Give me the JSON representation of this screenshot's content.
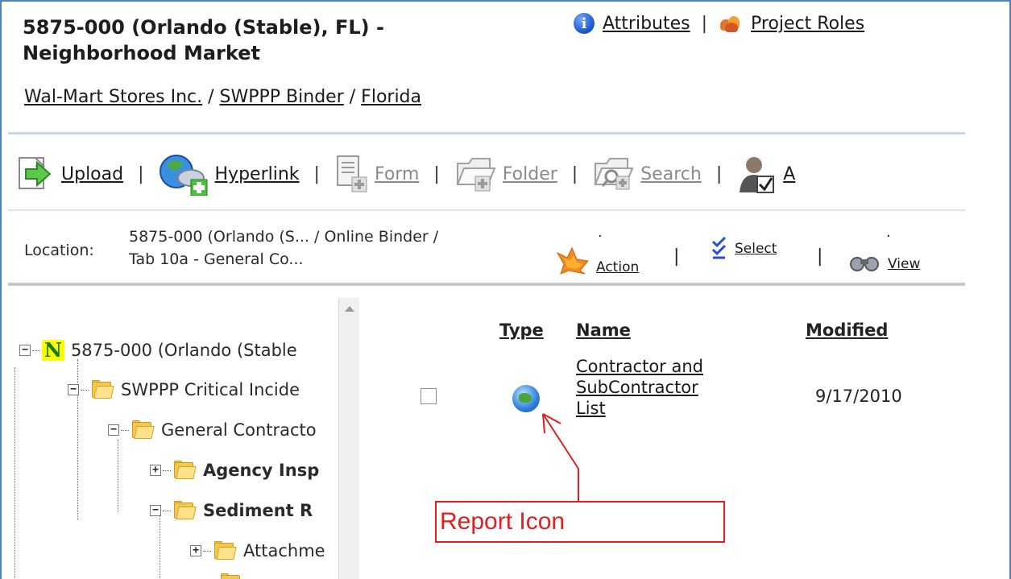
{
  "header": {
    "title": "5875-000 (Orlando (Stable), FL) - Neighborhood Market",
    "attributes_label": "Attributes",
    "separator": "|",
    "project_roles_label": "Project Roles"
  },
  "breadcrumb": {
    "items": [
      "Wal-Mart Stores Inc.",
      "SWPPP Binder",
      "Florida"
    ],
    "separator": " / "
  },
  "toolbar": {
    "items": [
      {
        "label": "Upload",
        "icon": "upload-icon",
        "enabled": true
      },
      {
        "label": "Hyperlink",
        "icon": "hyperlink-globe-icon",
        "enabled": true
      },
      {
        "label": "Form",
        "icon": "form-icon",
        "enabled": false
      },
      {
        "label": "Folder",
        "icon": "folder-add-icon",
        "enabled": false
      },
      {
        "label": "Search",
        "icon": "search-folder-icon",
        "enabled": false
      },
      {
        "label": "A",
        "icon": "approve-user-icon",
        "enabled": true
      }
    ]
  },
  "location": {
    "label": "Location:",
    "path_line1": "5875-000 (Orlando (S... / Online Binder /",
    "path_line2": "Tab 10a - General Co...",
    "action_label": "Action",
    "select_label": "Select",
    "view_label": "View",
    "dot": "."
  },
  "tree": {
    "items": [
      {
        "label": "5875-000 (Orlando (Stable",
        "bold": false,
        "toggle": "⊟",
        "icon": "n-badge"
      },
      {
        "label": "SWPPP Critical Incide",
        "bold": false,
        "toggle": "⊟",
        "icon": "folder-icon"
      },
      {
        "label": "General Contracto",
        "bold": false,
        "toggle": "⊟",
        "icon": "folder-icon"
      },
      {
        "label": "Agency Insp",
        "bold": true,
        "toggle": "⊞",
        "icon": "folder-icon"
      },
      {
        "label": "Sediment R",
        "bold": true,
        "toggle": "⊟",
        "icon": "folder-icon"
      },
      {
        "label": "Attachme",
        "bold": false,
        "toggle": "⊞",
        "icon": "folder-icon"
      }
    ],
    "root_badge": "N"
  },
  "files": {
    "columns": {
      "type": "Type",
      "name": "Name",
      "modified": "Modified"
    },
    "rows": [
      {
        "name_line1": "Contractor and",
        "name_line2": "SubContractor",
        "name_line3": "List",
        "modified": "9/17/2010",
        "type_icon": "report-globe-icon"
      }
    ]
  },
  "annotation": {
    "label": "Report Icon",
    "color": "#e02020"
  },
  "colors": {
    "frame": "#4f81bd",
    "divider": "#c9d9e3",
    "folder": "#f3c84f",
    "badge_bg": "#ffff00",
    "badge_fg": "#0f7d0f"
  }
}
